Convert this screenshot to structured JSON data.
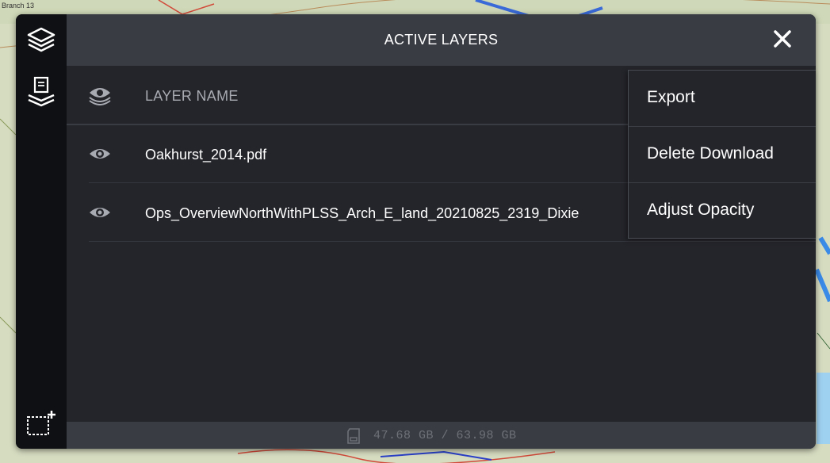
{
  "map": {
    "corner_label": "Branch 13"
  },
  "rail": {
    "items": [
      {
        "icon": "layers-icon"
      },
      {
        "icon": "document-layers-icon"
      },
      {
        "icon": "add-area-icon"
      }
    ]
  },
  "header": {
    "title": "ACTIVE LAYERS",
    "close_icon": "close-icon"
  },
  "table": {
    "column_header": "LAYER NAME",
    "rows": [
      {
        "name": "Oakhurst_2014.pdf",
        "visible": true
      },
      {
        "name": "Ops_OverviewNorthWithPLSS_Arch_E_land_20210825_2319_Dixie",
        "visible": true
      }
    ]
  },
  "context_menu": {
    "items": [
      {
        "label": "Export"
      },
      {
        "label": "Delete Download"
      },
      {
        "label": "Adjust Opacity"
      }
    ]
  },
  "footer": {
    "storage": "47.68 GB / 63.98 GB"
  },
  "colors": {
    "panel_bg": "#24252b",
    "header_bg": "#3a3c44",
    "rail_bg": "#0f1013",
    "text_primary": "#ffffff",
    "text_muted": "#a9abb2"
  }
}
